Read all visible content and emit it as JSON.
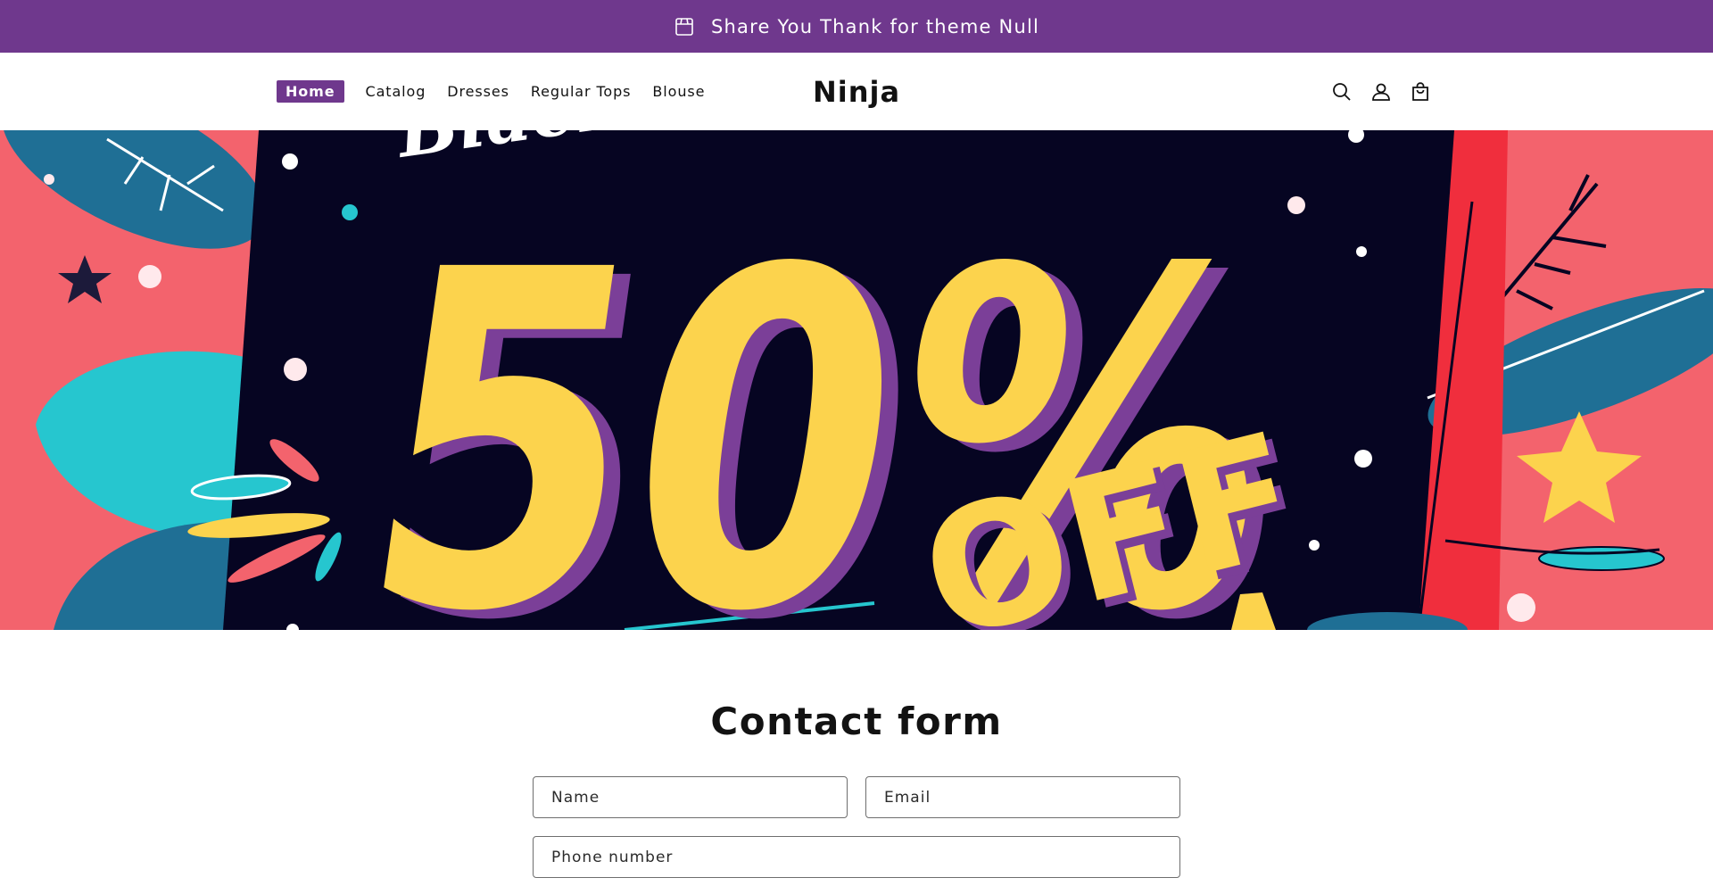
{
  "announcement": {
    "text": "Share You Thank for theme Null",
    "icon": "store-icon",
    "background": "#6f388d"
  },
  "header": {
    "logo": "Ninja",
    "nav": [
      {
        "label": "Home",
        "active": true
      },
      {
        "label": "Catalog",
        "active": false
      },
      {
        "label": "Dresses",
        "active": false
      },
      {
        "label": "Regular Tops",
        "active": false
      },
      {
        "label": "Blouse",
        "active": false
      }
    ],
    "icons": [
      "search-icon",
      "account-icon",
      "cart-icon"
    ],
    "accent": "#6f388d"
  },
  "banner": {
    "text_top": "Black",
    "big_text": "50%",
    "off_text": "OFF",
    "colors": {
      "coral": "#f3636d",
      "navy": "#060522",
      "yellow": "#fcd34d",
      "purple": "#7b3f98",
      "teal": "#26c6cf",
      "blue": "#1f6f95"
    }
  },
  "contact": {
    "title": "Contact form",
    "name_placeholder": "Name",
    "email_placeholder": "Email",
    "phone_placeholder": "Phone number"
  }
}
